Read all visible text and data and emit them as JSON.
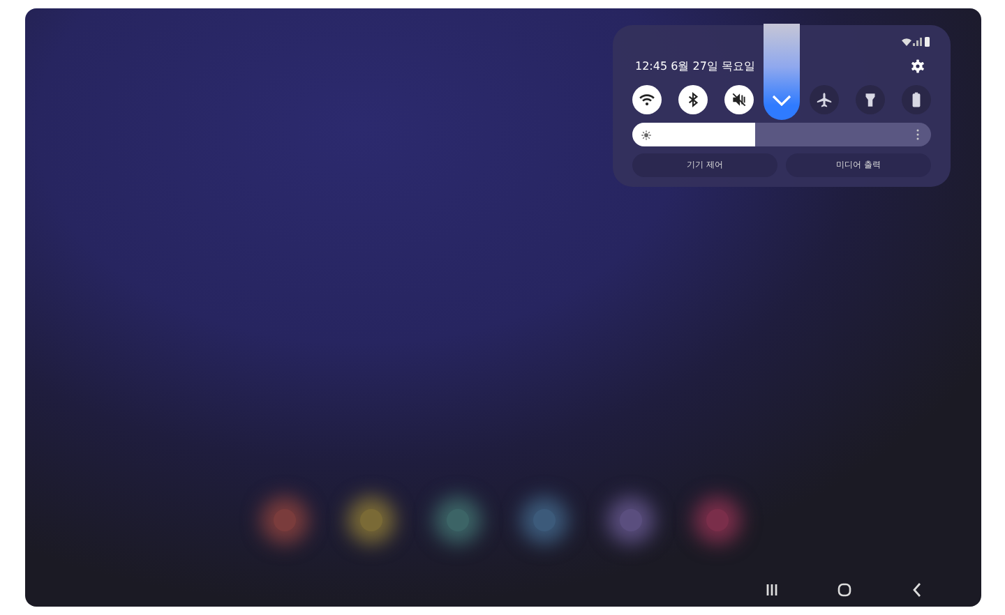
{
  "dock": [
    {
      "color": "#7a3c3c"
    },
    {
      "color": "#7a6a36"
    },
    {
      "color": "#3c6466"
    },
    {
      "color": "#3c5a7a"
    },
    {
      "color": "#5a4e7e"
    },
    {
      "color": "#7a2e4a"
    }
  ],
  "quick_panel": {
    "clock": "12:45 6월 27일 목요일",
    "toggles": [
      {
        "kind": "wifi",
        "on": true
      },
      {
        "kind": "bluetooth",
        "on": true
      },
      {
        "kind": "mute",
        "on": true
      },
      {
        "kind": "airplane",
        "on": false
      },
      {
        "kind": "flashlight",
        "on": false
      },
      {
        "kind": "battery",
        "on": false
      }
    ],
    "brightness": {
      "level": 0.41
    },
    "buttons": [
      "기기 제어",
      "미디어 출력"
    ]
  }
}
